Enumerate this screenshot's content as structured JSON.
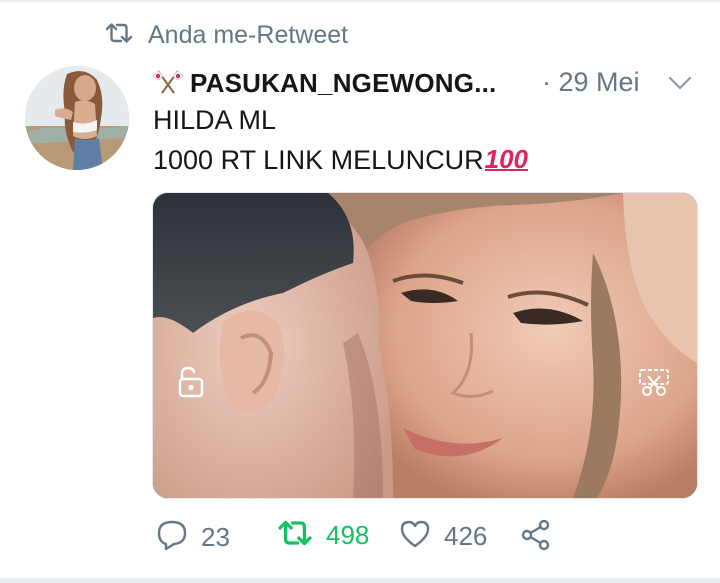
{
  "retweet_context": {
    "text": "Anda me-Retweet"
  },
  "tweet": {
    "display_name": "PASUKAN_NGEWONG...",
    "date": "29 Mei",
    "date_separator": "·",
    "lines": [
      "HILDA ML",
      "1000 RT LINK MELUNCUR"
    ],
    "hundred_emoji": "100"
  },
  "actions": {
    "replies": "23",
    "retweets": "498",
    "likes": "426"
  },
  "colors": {
    "retweet_active": "#17bf63",
    "muted": "#657786",
    "text": "#14171a",
    "emoji_red": "#e0245e"
  },
  "icons": {
    "retweet_context": "retweet-icon",
    "name_emoji": "crossed-flags-icon",
    "menu": "chevron-down-icon",
    "media_left": "unlock-icon",
    "media_right": "scissors-icon",
    "reply": "reply-icon",
    "retweet": "retweet-icon",
    "like": "heart-icon",
    "share": "share-icon"
  }
}
